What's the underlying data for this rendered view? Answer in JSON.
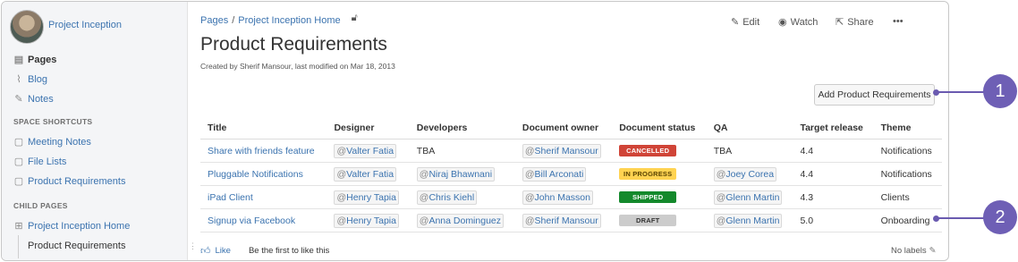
{
  "sidebar": {
    "space_name": "Project Inception",
    "nav": [
      {
        "label": "Pages",
        "icon": "pages-icon"
      },
      {
        "label": "Blog",
        "icon": "blog-icon"
      },
      {
        "label": "Notes",
        "icon": "notes-icon"
      }
    ],
    "shortcuts_heading": "SPACE SHORTCUTS",
    "shortcuts": [
      {
        "label": "Meeting Notes",
        "icon": "shortcut-page-icon"
      },
      {
        "label": "File Lists",
        "icon": "shortcut-page-icon"
      },
      {
        "label": "Product Requirements",
        "icon": "shortcut-page-icon"
      }
    ],
    "child_heading": "CHILD PAGES",
    "child_parent": "Project Inception Home",
    "child_current": "Product Requirements"
  },
  "breadcrumb": {
    "root": "Pages",
    "separator": "/",
    "parent": "Project Inception Home"
  },
  "actions": {
    "edit": "Edit",
    "watch": "Watch",
    "share": "Share",
    "more": "•••"
  },
  "page": {
    "title": "Product Requirements",
    "byline": "Created by Sherif Mansour, last modified on Mar 18, 2013",
    "add_button": "Add Product Requirements"
  },
  "table": {
    "headers": [
      "Title",
      "Designer",
      "Developers",
      "Document owner",
      "Document status",
      "QA",
      "Target release",
      "Theme"
    ],
    "rows": [
      {
        "title": "Share with friends feature",
        "designer": "Valter Fatia",
        "developers": "TBA",
        "developers_mention": false,
        "owner": "Sherif Mansour",
        "status": "CANCELLED",
        "status_kind": "cancelled",
        "qa": "TBA",
        "qa_mention": false,
        "release": "4.4",
        "theme": "Notifications"
      },
      {
        "title": "Pluggable Notifications",
        "designer": "Valter Fatia",
        "developers": "Niraj Bhawnani",
        "developers_mention": true,
        "owner": "Bill Arconati",
        "status": "IN PROGRESS",
        "status_kind": "progress",
        "qa": "Joey Corea",
        "qa_mention": true,
        "release": "4.4",
        "theme": "Notifications"
      },
      {
        "title": "iPad Client",
        "designer": "Henry Tapia",
        "developers": "Chris Kiehl",
        "developers_mention": true,
        "owner": "John Masson",
        "status": "SHIPPED",
        "status_kind": "shipped",
        "qa": "Glenn Martin",
        "qa_mention": true,
        "release": "4.3",
        "theme": "Clients"
      },
      {
        "title": "Signup via Facebook",
        "designer": "Henry Tapia",
        "developers": "Anna Dominguez",
        "developers_mention": true,
        "owner": "Sherif Mansour",
        "status": "DRAFT",
        "status_kind": "draft",
        "qa": "Glenn Martin",
        "qa_mention": true,
        "release": "5.0",
        "theme": "Onboarding"
      }
    ]
  },
  "footer": {
    "like": "Like",
    "like_text": "Be the first to like this",
    "labels": "No labels"
  },
  "callouts": [
    "1",
    "2"
  ],
  "colors": {
    "link": "#3b73af",
    "callout": "#6e5fb5",
    "cancelled": "#d04437",
    "in_progress": "#ffd351",
    "shipped": "#14892c",
    "draft": "#cccccc"
  }
}
